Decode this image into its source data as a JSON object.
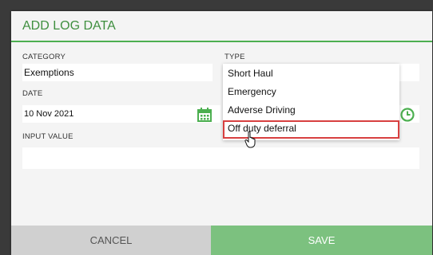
{
  "dialog": {
    "title": "ADD LOG DATA",
    "category": {
      "label": "CATEGORY",
      "value": "Exemptions"
    },
    "type": {
      "label": "TYPE",
      "options": [
        "Short Haul",
        "Emergency",
        "Adverse Driving",
        "Off duty deferral"
      ],
      "highlighted": "Off duty deferral"
    },
    "date": {
      "label": "DATE",
      "value": "10 Nov 2021"
    },
    "input_value": {
      "label": "INPUT VALUE",
      "value": ""
    },
    "cancel_label": "CANCEL",
    "save_label": "SAVE"
  },
  "colors": {
    "accent": "#4caf50",
    "save": "#7cc17f",
    "highlight": "#d84040"
  }
}
